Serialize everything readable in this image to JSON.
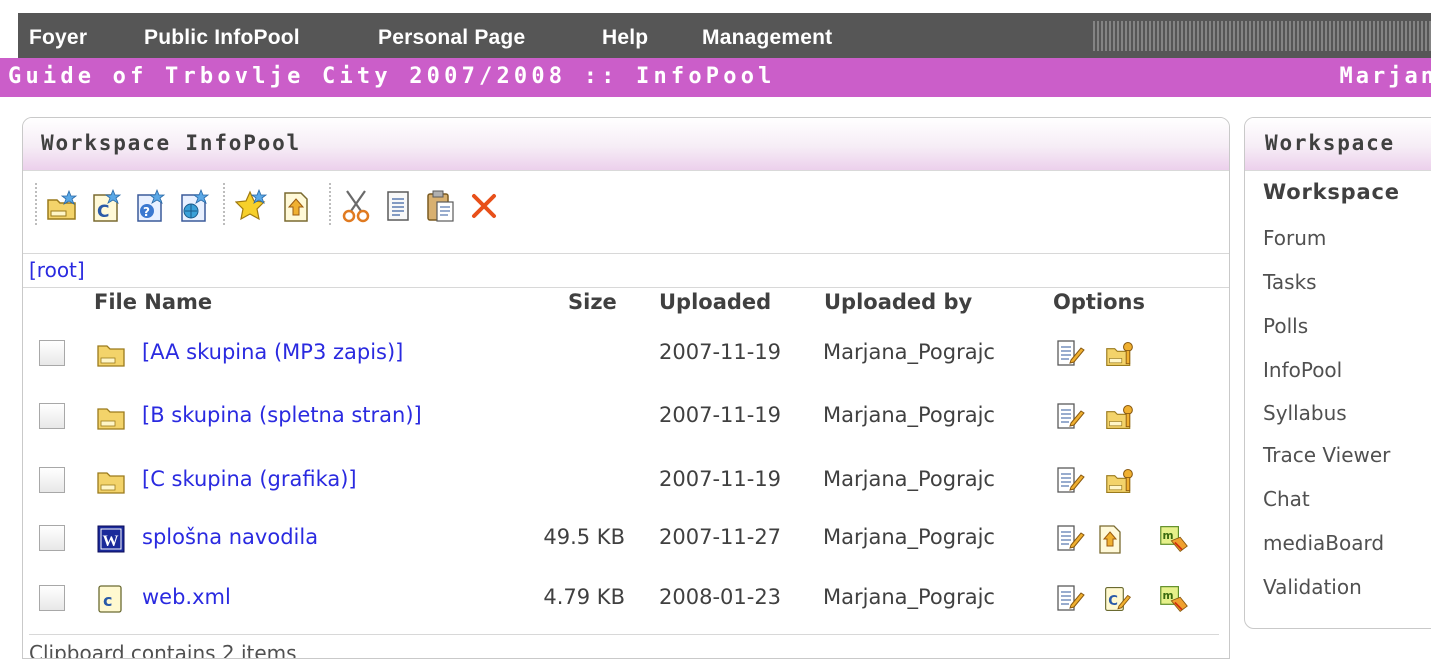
{
  "nav": {
    "items": [
      "Foyer",
      "Public InfoPool",
      "Personal Page",
      "Help",
      "Management"
    ]
  },
  "header": {
    "title": "Guide of Trbovlje City 2007/2008 :: InfoPool",
    "user": "Marjan"
  },
  "workspace": {
    "title": "Workspace InfoPool",
    "toolbar_icons": [
      "new-folder-icon",
      "new-c-file-icon",
      "new-help-file-icon",
      "new-web-file-icon",
      "favorite-star-icon",
      "upload-icon",
      "cut-icon",
      "copy-icon",
      "paste-icon",
      "delete-icon"
    ],
    "breadcrumb": "[root]",
    "columns": {
      "name": "File Name",
      "size": "Size",
      "uploaded": "Uploaded",
      "uploaded_by": "Uploaded by",
      "options": "Options"
    },
    "rows": [
      {
        "type": "folder",
        "name": "[AA skupina (MP3 zapis)]",
        "size": "",
        "uploaded": "2007-11-19",
        "by": "Marjana_Pograjc"
      },
      {
        "type": "folder",
        "name": "[B skupina (spletna stran)]",
        "size": "",
        "uploaded": "2007-11-19",
        "by": "Marjana_Pograjc"
      },
      {
        "type": "folder",
        "name": "[C skupina (grafika)]",
        "size": "",
        "uploaded": "2007-11-19",
        "by": "Marjana_Pograjc"
      },
      {
        "type": "word",
        "name": "splošna navodila",
        "size": "49.5 KB",
        "uploaded": "2007-11-27",
        "by": "Marjana_Pograjc"
      },
      {
        "type": "c-file",
        "name": "web.xml",
        "size": "4.79 KB",
        "uploaded": "2008-01-23",
        "by": "Marjana_Pograjc"
      }
    ],
    "clipboard": "Clipboard contains 2 items"
  },
  "sidebar": {
    "title": "Workspace",
    "subtitle": "Workspace",
    "links": [
      "Forum",
      "Tasks",
      "Polls",
      "InfoPool",
      "Syllabus",
      "Trace Viewer",
      "Chat",
      "mediaBoard",
      "Validation"
    ]
  },
  "colors": {
    "nav_bg": "#565656",
    "header_bg": "#cb5ec9",
    "link": "#2a2ae0",
    "panel_title_tint": "#ecd0ec"
  }
}
